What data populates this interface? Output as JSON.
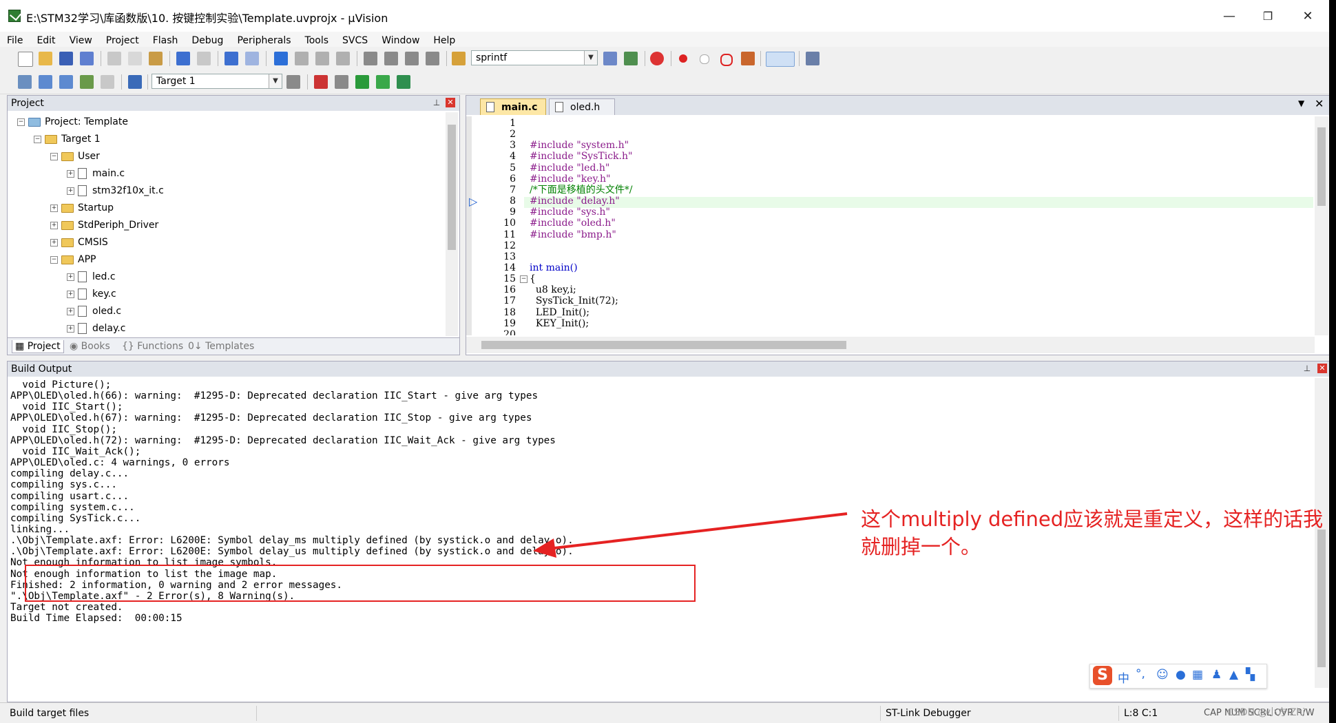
{
  "window": {
    "title": "E:\\STM32学习\\库函数版\\10. 按键控制实验\\Template.uvprojx - µVision",
    "minimize": "—",
    "restore": "❐",
    "close": "✕"
  },
  "menu": [
    "File",
    "Edit",
    "View",
    "Project",
    "Flash",
    "Debug",
    "Peripherals",
    "Tools",
    "SVCS",
    "Window",
    "Help"
  ],
  "toolbar": {
    "find_combo": "sprintf",
    "target_combo": "Target 1"
  },
  "project_panel": {
    "title": "Project",
    "tree": [
      {
        "label": "Project: Template",
        "level": 0,
        "type": "project",
        "expanded": true
      },
      {
        "label": "Target 1",
        "level": 1,
        "type": "target",
        "expanded": true
      },
      {
        "label": "User",
        "level": 2,
        "type": "folder",
        "expanded": true
      },
      {
        "label": "main.c",
        "level": 3,
        "type": "file"
      },
      {
        "label": "stm32f10x_it.c",
        "level": 3,
        "type": "file"
      },
      {
        "label": "Startup",
        "level": 2,
        "type": "folder",
        "expanded": false
      },
      {
        "label": "StdPeriph_Driver",
        "level": 2,
        "type": "folder",
        "expanded": false
      },
      {
        "label": "CMSIS",
        "level": 2,
        "type": "folder",
        "expanded": false
      },
      {
        "label": "APP",
        "level": 2,
        "type": "folder",
        "expanded": true
      },
      {
        "label": "led.c",
        "level": 3,
        "type": "file"
      },
      {
        "label": "key.c",
        "level": 3,
        "type": "file"
      },
      {
        "label": "oled.c",
        "level": 3,
        "type": "file"
      },
      {
        "label": "delay.c",
        "level": 3,
        "type": "file"
      }
    ],
    "tabs": [
      "Project",
      "Books",
      "Functions",
      "Templates"
    ]
  },
  "editor": {
    "tabs": [
      {
        "label": "main.c",
        "active": true
      },
      {
        "label": "oled.h",
        "active": false
      }
    ],
    "lines": [
      {
        "n": "1",
        "text": ""
      },
      {
        "n": "2",
        "text": ""
      },
      {
        "n": "3",
        "text": "#include \"system.h\""
      },
      {
        "n": "4",
        "text": "#include \"SysTick.h\""
      },
      {
        "n": "5",
        "text": "#include \"led.h\""
      },
      {
        "n": "6",
        "text": "#include \"key.h\""
      },
      {
        "n": "7",
        "text": "/*下面是移植的头文件*/"
      },
      {
        "n": "8",
        "text": "#include \"delay.h\""
      },
      {
        "n": "9",
        "text": "#include \"sys.h\""
      },
      {
        "n": "10",
        "text": "#include \"oled.h\""
      },
      {
        "n": "11",
        "text": "#include \"bmp.h\""
      },
      {
        "n": "12",
        "text": ""
      },
      {
        "n": "13",
        "text": ""
      },
      {
        "n": "14",
        "text": "int main()"
      },
      {
        "n": "15",
        "text": "{"
      },
      {
        "n": "16",
        "text": "  u8 key,i;"
      },
      {
        "n": "17",
        "text": "  SysTick_Init(72);"
      },
      {
        "n": "18",
        "text": "  LED_Init();"
      },
      {
        "n": "19",
        "text": "  KEY_Init();"
      },
      {
        "n": "20",
        "text": ""
      }
    ]
  },
  "build_output": {
    "title": "Build Output",
    "lines": [
      "  void Picture();",
      "APP\\OLED\\oled.h(66): warning:  #1295-D: Deprecated declaration IIC_Start - give arg types",
      "  void IIC_Start();",
      "APP\\OLED\\oled.h(67): warning:  #1295-D: Deprecated declaration IIC_Stop - give arg types",
      "  void IIC_Stop();",
      "APP\\OLED\\oled.h(72): warning:  #1295-D: Deprecated declaration IIC_Wait_Ack - give arg types",
      "  void IIC_Wait_Ack();",
      "APP\\OLED\\oled.c: 4 warnings, 0 errors",
      "compiling delay.c...",
      "compiling sys.c...",
      "compiling usart.c...",
      "compiling system.c...",
      "compiling SysTick.c...",
      "linking...",
      ".\\Obj\\Template.axf: Error: L6200E: Symbol delay_ms multiply defined (by systick.o and delay.o).",
      ".\\Obj\\Template.axf: Error: L6200E: Symbol delay_us multiply defined (by systick.o and delay.o).",
      "Not enough information to list image symbols.",
      "Not enough information to list the image map.",
      "Finished: 2 information, 0 warning and 2 error messages.",
      "\".\\Obj\\Template.axf\" - 2 Error(s), 8 Warning(s).",
      "Target not created.",
      "Build Time Elapsed:  00:00:15"
    ]
  },
  "annotation": {
    "text_line1": "这个multiply defined应该就是重定义，这样的话我",
    "text_line2": "就删掉一个。",
    "color": "#e52222"
  },
  "ime_bar": {
    "logo": "S",
    "lang": "中",
    "punct": "°,"
  },
  "status": {
    "left": "Build target files",
    "debugger": "ST-Link Debugger",
    "position": "L:8 C:1",
    "caps": "CAP  NUM  SCRL  OVR R/W",
    "watermark": "CSDN @小方 Zhi"
  }
}
